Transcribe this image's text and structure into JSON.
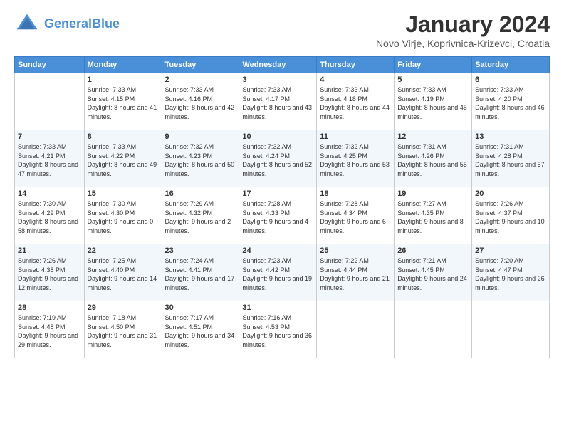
{
  "header": {
    "logo_line1": "General",
    "logo_line2": "Blue",
    "month": "January 2024",
    "location": "Novo Virje, Koprivnica-Krizevci, Croatia"
  },
  "weekdays": [
    "Sunday",
    "Monday",
    "Tuesday",
    "Wednesday",
    "Thursday",
    "Friday",
    "Saturday"
  ],
  "weeks": [
    [
      {
        "day": "",
        "sunrise": "",
        "sunset": "",
        "daylight": ""
      },
      {
        "day": "1",
        "sunrise": "Sunrise: 7:33 AM",
        "sunset": "Sunset: 4:15 PM",
        "daylight": "Daylight: 8 hours and 41 minutes."
      },
      {
        "day": "2",
        "sunrise": "Sunrise: 7:33 AM",
        "sunset": "Sunset: 4:16 PM",
        "daylight": "Daylight: 8 hours and 42 minutes."
      },
      {
        "day": "3",
        "sunrise": "Sunrise: 7:33 AM",
        "sunset": "Sunset: 4:17 PM",
        "daylight": "Daylight: 8 hours and 43 minutes."
      },
      {
        "day": "4",
        "sunrise": "Sunrise: 7:33 AM",
        "sunset": "Sunset: 4:18 PM",
        "daylight": "Daylight: 8 hours and 44 minutes."
      },
      {
        "day": "5",
        "sunrise": "Sunrise: 7:33 AM",
        "sunset": "Sunset: 4:19 PM",
        "daylight": "Daylight: 8 hours and 45 minutes."
      },
      {
        "day": "6",
        "sunrise": "Sunrise: 7:33 AM",
        "sunset": "Sunset: 4:20 PM",
        "daylight": "Daylight: 8 hours and 46 minutes."
      }
    ],
    [
      {
        "day": "7",
        "sunrise": "Sunrise: 7:33 AM",
        "sunset": "Sunset: 4:21 PM",
        "daylight": "Daylight: 8 hours and 47 minutes."
      },
      {
        "day": "8",
        "sunrise": "Sunrise: 7:33 AM",
        "sunset": "Sunset: 4:22 PM",
        "daylight": "Daylight: 8 hours and 49 minutes."
      },
      {
        "day": "9",
        "sunrise": "Sunrise: 7:32 AM",
        "sunset": "Sunset: 4:23 PM",
        "daylight": "Daylight: 8 hours and 50 minutes."
      },
      {
        "day": "10",
        "sunrise": "Sunrise: 7:32 AM",
        "sunset": "Sunset: 4:24 PM",
        "daylight": "Daylight: 8 hours and 52 minutes."
      },
      {
        "day": "11",
        "sunrise": "Sunrise: 7:32 AM",
        "sunset": "Sunset: 4:25 PM",
        "daylight": "Daylight: 8 hours and 53 minutes."
      },
      {
        "day": "12",
        "sunrise": "Sunrise: 7:31 AM",
        "sunset": "Sunset: 4:26 PM",
        "daylight": "Daylight: 8 hours and 55 minutes."
      },
      {
        "day": "13",
        "sunrise": "Sunrise: 7:31 AM",
        "sunset": "Sunset: 4:28 PM",
        "daylight": "Daylight: 8 hours and 57 minutes."
      }
    ],
    [
      {
        "day": "14",
        "sunrise": "Sunrise: 7:30 AM",
        "sunset": "Sunset: 4:29 PM",
        "daylight": "Daylight: 8 hours and 58 minutes."
      },
      {
        "day": "15",
        "sunrise": "Sunrise: 7:30 AM",
        "sunset": "Sunset: 4:30 PM",
        "daylight": "Daylight: 9 hours and 0 minutes."
      },
      {
        "day": "16",
        "sunrise": "Sunrise: 7:29 AM",
        "sunset": "Sunset: 4:32 PM",
        "daylight": "Daylight: 9 hours and 2 minutes."
      },
      {
        "day": "17",
        "sunrise": "Sunrise: 7:28 AM",
        "sunset": "Sunset: 4:33 PM",
        "daylight": "Daylight: 9 hours and 4 minutes."
      },
      {
        "day": "18",
        "sunrise": "Sunrise: 7:28 AM",
        "sunset": "Sunset: 4:34 PM",
        "daylight": "Daylight: 9 hours and 6 minutes."
      },
      {
        "day": "19",
        "sunrise": "Sunrise: 7:27 AM",
        "sunset": "Sunset: 4:35 PM",
        "daylight": "Daylight: 9 hours and 8 minutes."
      },
      {
        "day": "20",
        "sunrise": "Sunrise: 7:26 AM",
        "sunset": "Sunset: 4:37 PM",
        "daylight": "Daylight: 9 hours and 10 minutes."
      }
    ],
    [
      {
        "day": "21",
        "sunrise": "Sunrise: 7:26 AM",
        "sunset": "Sunset: 4:38 PM",
        "daylight": "Daylight: 9 hours and 12 minutes."
      },
      {
        "day": "22",
        "sunrise": "Sunrise: 7:25 AM",
        "sunset": "Sunset: 4:40 PM",
        "daylight": "Daylight: 9 hours and 14 minutes."
      },
      {
        "day": "23",
        "sunrise": "Sunrise: 7:24 AM",
        "sunset": "Sunset: 4:41 PM",
        "daylight": "Daylight: 9 hours and 17 minutes."
      },
      {
        "day": "24",
        "sunrise": "Sunrise: 7:23 AM",
        "sunset": "Sunset: 4:42 PM",
        "daylight": "Daylight: 9 hours and 19 minutes."
      },
      {
        "day": "25",
        "sunrise": "Sunrise: 7:22 AM",
        "sunset": "Sunset: 4:44 PM",
        "daylight": "Daylight: 9 hours and 21 minutes."
      },
      {
        "day": "26",
        "sunrise": "Sunrise: 7:21 AM",
        "sunset": "Sunset: 4:45 PM",
        "daylight": "Daylight: 9 hours and 24 minutes."
      },
      {
        "day": "27",
        "sunrise": "Sunrise: 7:20 AM",
        "sunset": "Sunset: 4:47 PM",
        "daylight": "Daylight: 9 hours and 26 minutes."
      }
    ],
    [
      {
        "day": "28",
        "sunrise": "Sunrise: 7:19 AM",
        "sunset": "Sunset: 4:48 PM",
        "daylight": "Daylight: 9 hours and 29 minutes."
      },
      {
        "day": "29",
        "sunrise": "Sunrise: 7:18 AM",
        "sunset": "Sunset: 4:50 PM",
        "daylight": "Daylight: 9 hours and 31 minutes."
      },
      {
        "day": "30",
        "sunrise": "Sunrise: 7:17 AM",
        "sunset": "Sunset: 4:51 PM",
        "daylight": "Daylight: 9 hours and 34 minutes."
      },
      {
        "day": "31",
        "sunrise": "Sunrise: 7:16 AM",
        "sunset": "Sunset: 4:53 PM",
        "daylight": "Daylight: 9 hours and 36 minutes."
      },
      {
        "day": "",
        "sunrise": "",
        "sunset": "",
        "daylight": ""
      },
      {
        "day": "",
        "sunrise": "",
        "sunset": "",
        "daylight": ""
      },
      {
        "day": "",
        "sunrise": "",
        "sunset": "",
        "daylight": ""
      }
    ]
  ]
}
